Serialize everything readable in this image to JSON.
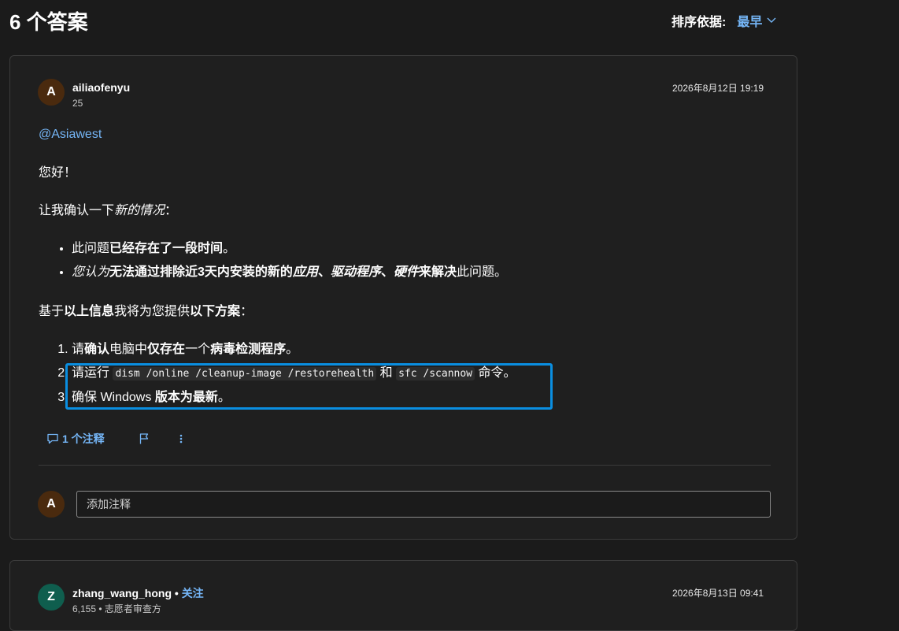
{
  "page": {
    "title": "6 个答案"
  },
  "sort": {
    "label": "排序依据:",
    "value": "最早"
  },
  "answers": [
    {
      "author": "ailiaofenyu",
      "avatar_letter": "A",
      "reputation": "25",
      "timestamp": "2026年8月12日 19:19",
      "mention": "@Asiawest",
      "greeting": "您好！",
      "intro": {
        "prefix": "让我确认一下",
        "emph": "新的情况",
        "suffix": "："
      },
      "bullets": [
        {
          "parts": [
            "此问题",
            "已经存在了一段时间",
            "。"
          ]
        },
        {
          "parts": [
            "您认为",
            "无法通过排除近3天内安装的新的",
            "应用",
            "、",
            "驱动程序",
            "、",
            "硬件",
            "来解决",
            "此问题。"
          ]
        }
      ],
      "plan": {
        "prefix": "基于",
        "bold1": "以上信息",
        "mid": "我将为您提供",
        "bold2": "以下方案",
        "suffix": "："
      },
      "steps": [
        {
          "parts": [
            "请",
            "确认",
            "电脑中",
            "仅存在",
            "一个",
            "病毒检测程序",
            "。"
          ]
        },
        {
          "parts": [
            "请运行 ",
            "dism /online /cleanup-image /restorehealth",
            " 和 ",
            "sfc /scannow",
            " 命令。"
          ]
        },
        {
          "parts": [
            "确保 Windows ",
            "版本为最新",
            "。"
          ]
        }
      ],
      "comments_label": "1 个注释",
      "comment_avatar_letter": "A",
      "comment_placeholder": "添加注释"
    },
    {
      "author": "zhang_wang_hong",
      "avatar_letter": "Z",
      "follow_label": "关注",
      "separator": " • ",
      "timestamp": "2026年8月13日 09:41",
      "reputation": "6,155 • 志愿者审查方"
    }
  ],
  "colors": {
    "accent": "#75b6f7",
    "highlight": "#0a8ee0",
    "background": "#1b1b1b",
    "card": "#1f1f1f"
  }
}
